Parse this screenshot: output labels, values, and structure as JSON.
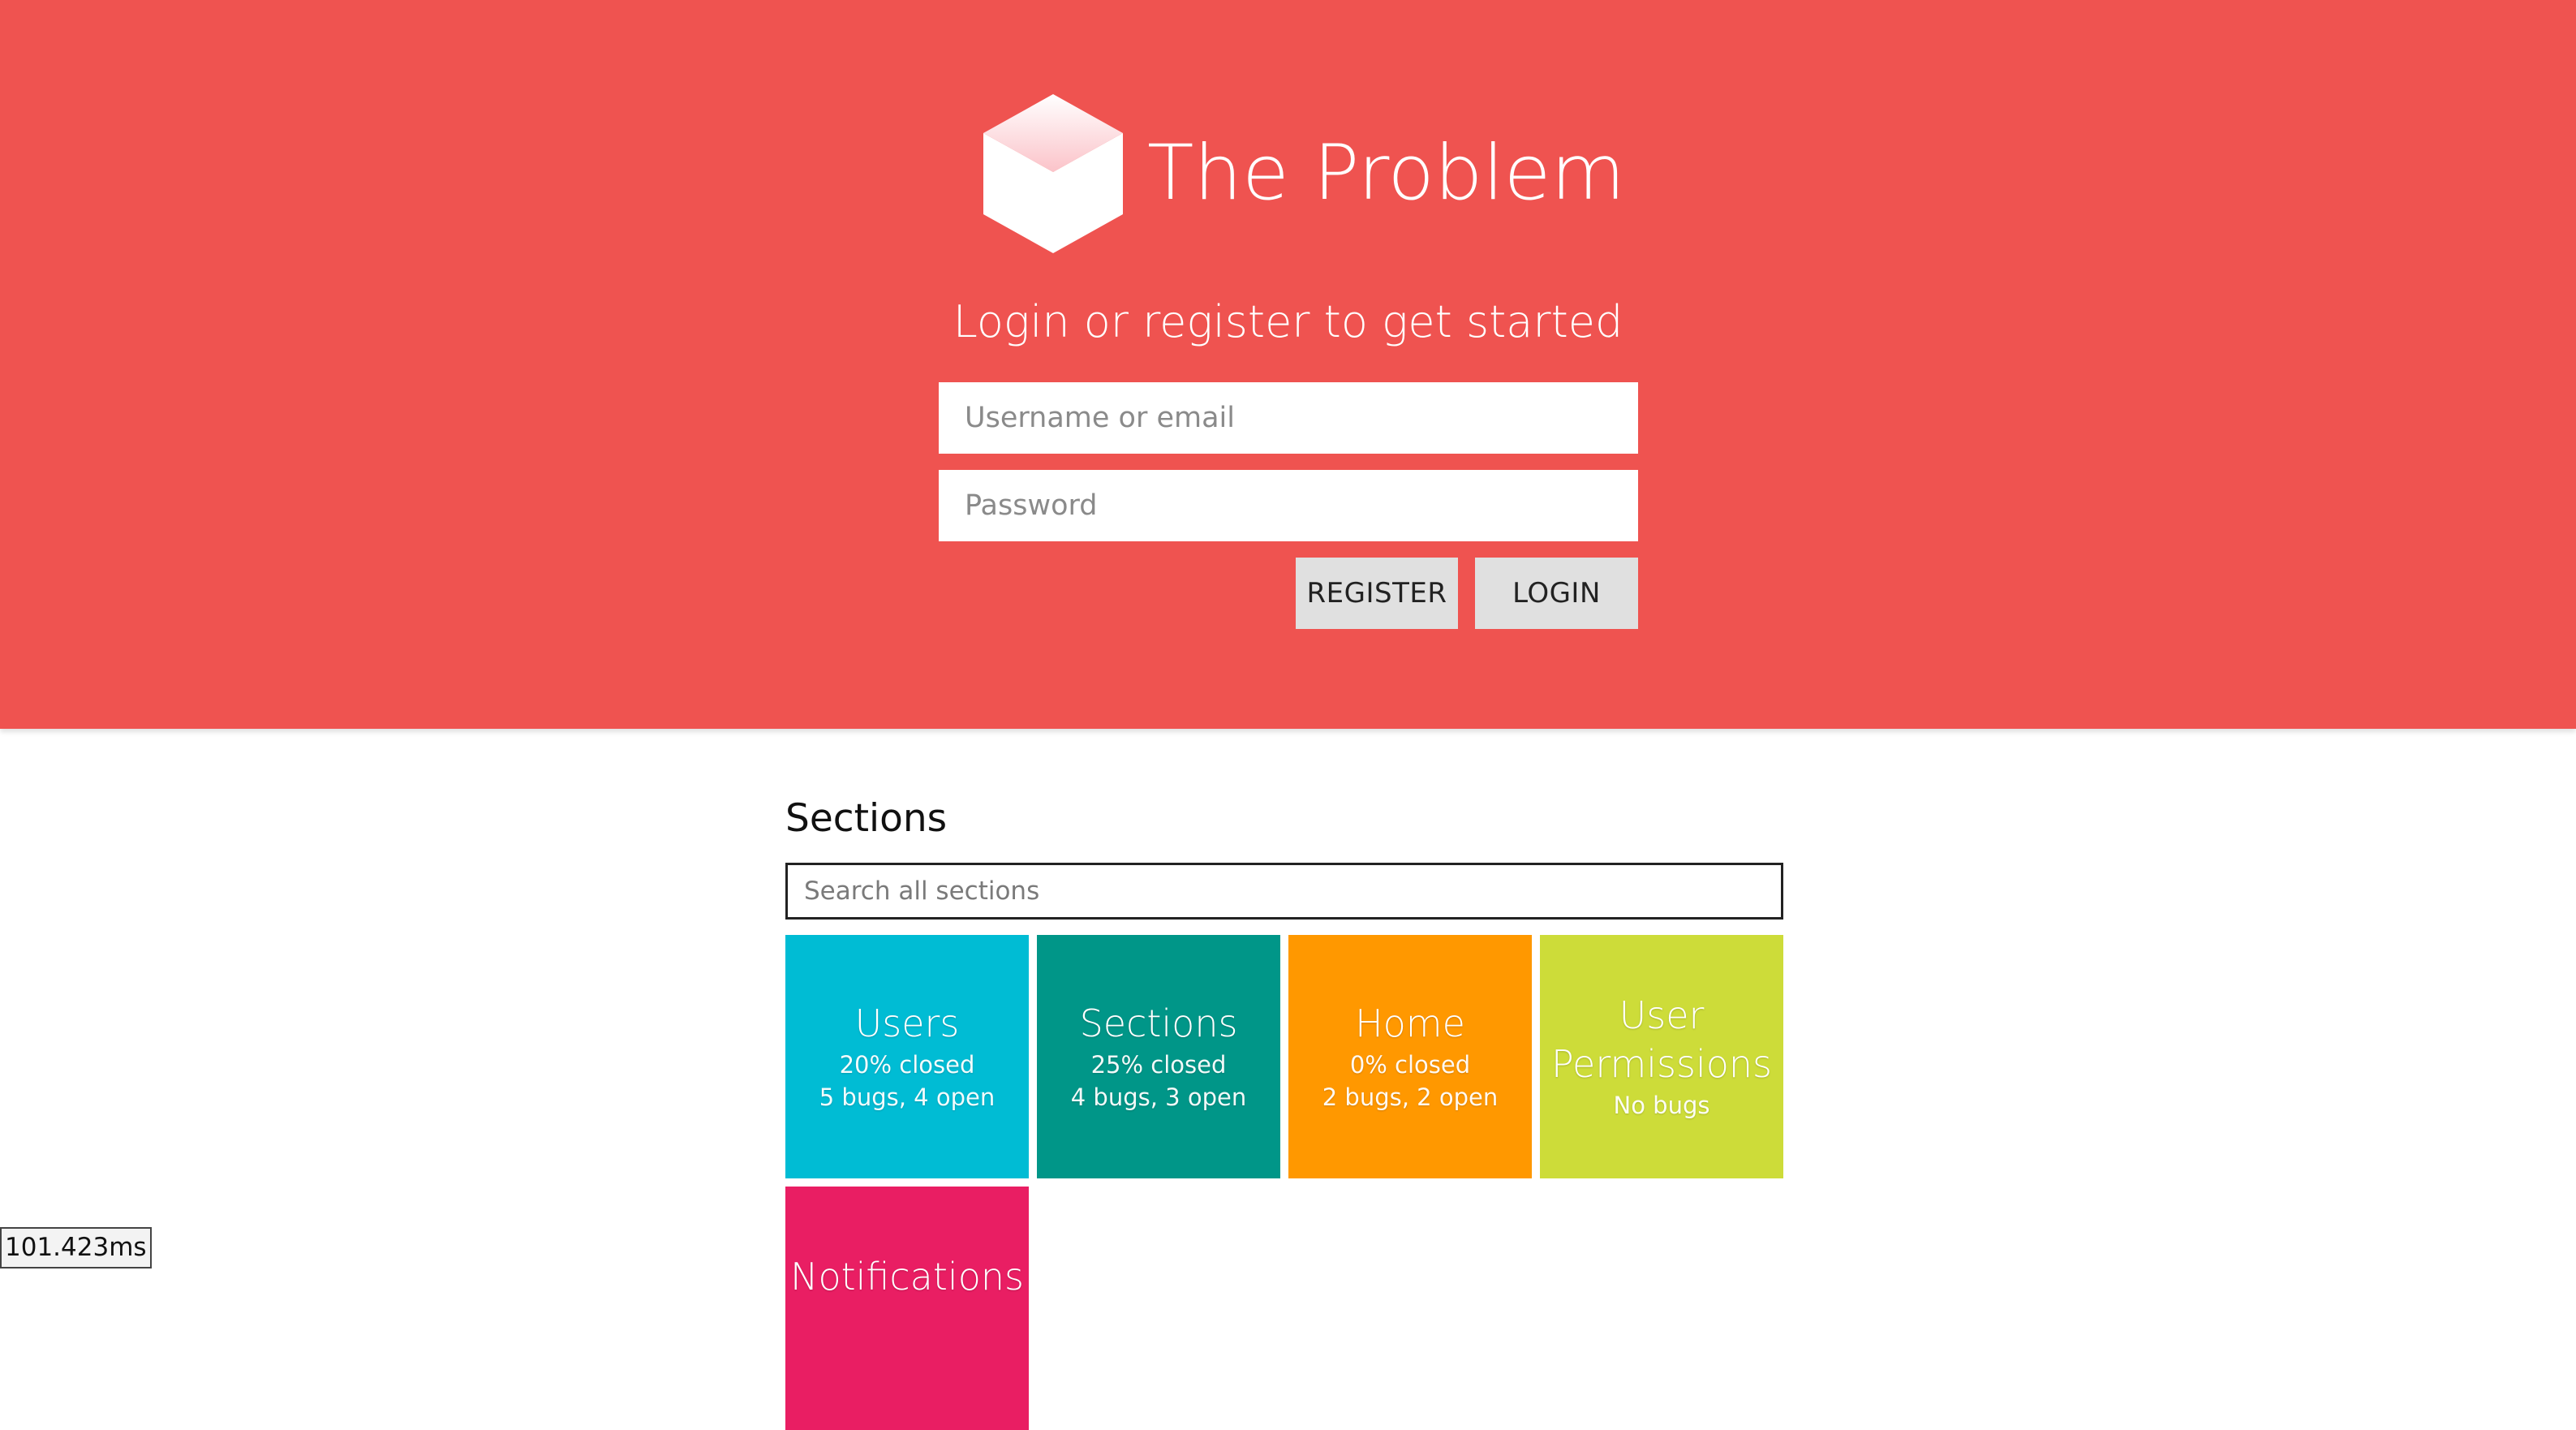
{
  "header": {
    "app_title": "The Problem",
    "subtitle": "Login or register to get started",
    "logo_icon": "cube-icon"
  },
  "login_form": {
    "username_placeholder": "Username or email",
    "password_placeholder": "Password",
    "register_label": "REGISTER",
    "login_label": "LOGIN"
  },
  "sections": {
    "heading": "Sections",
    "search_placeholder": "Search all sections",
    "items": [
      {
        "name": "Users",
        "closed": "20% closed",
        "bugs": "5 bugs, 4 open",
        "color": "#00bcd4"
      },
      {
        "name": "Sections",
        "closed": "25% closed",
        "bugs": "4 bugs, 3 open",
        "color": "#009688"
      },
      {
        "name": "Home",
        "closed": "0% closed",
        "bugs": "2 bugs, 2 open",
        "color": "#ff9800"
      },
      {
        "name": "User Permissions",
        "closed": "",
        "bugs": "No bugs",
        "color": "#cddc39"
      },
      {
        "name": "Notifications",
        "closed": "",
        "bugs": "",
        "color": "#e91e63"
      }
    ]
  },
  "debug": {
    "timing": "101.423ms"
  },
  "colors": {
    "hero_background": "#ef5350",
    "button_background": "#e0e0e0"
  }
}
